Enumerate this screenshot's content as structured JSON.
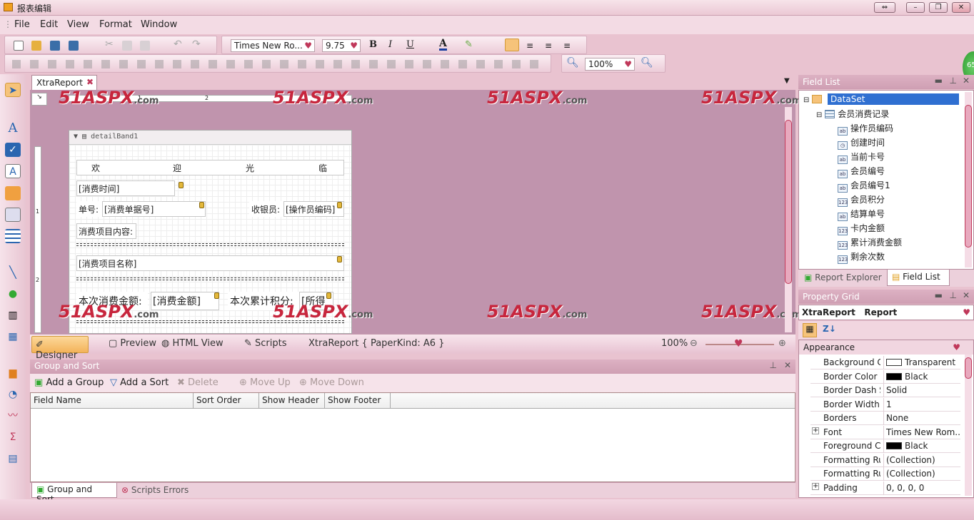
{
  "window": {
    "title": "报表编辑"
  },
  "menu": [
    "File",
    "Edit",
    "View",
    "Format",
    "Window"
  ],
  "font_toolbar": {
    "font_name": "Times New Ro...",
    "font_size": "9.75",
    "bold": "B",
    "italic": "I",
    "underline": "U",
    "font_color": "A"
  },
  "zoom_toolbar": {
    "zoom": "100%"
  },
  "doc_tab": {
    "label": "XtraReport"
  },
  "band": {
    "label": "detailBand1"
  },
  "report_cells": {
    "welcome": [
      "欢",
      "迎",
      "光",
      "临"
    ],
    "time": "[消费时间]",
    "order_label": "单号:",
    "order_field": "[消费单据号]",
    "cashier_label": "收银员:",
    "cashier_field": "[操作员编码]",
    "items_label": "消费项目内容:",
    "item_name": "[消费项目名称]",
    "amount_label": "本次消费金额:",
    "amount_field": "[消费金额]",
    "points_label": "本次累计积分:",
    "points_field": "[所得"
  },
  "watermark": {
    "brand": "51ASPX",
    "suffix": ".com"
  },
  "ruler": {
    "marks": [
      "1",
      "2"
    ]
  },
  "bottom_tabs": {
    "designer": "Designer",
    "preview": "Preview",
    "html_view": "HTML View",
    "scripts": "Scripts",
    "status": "XtraReport { PaperKind: A6 }",
    "zoom": "100%"
  },
  "group_sort": {
    "title": "Group and Sort",
    "tools": {
      "add_group": "Add a Group",
      "add_sort": "Add a Sort",
      "delete": "Delete",
      "move_up": "Move Up",
      "move_down": "Move Down"
    },
    "columns": [
      "Field Name",
      "Sort Order",
      "Show Header",
      "Show Footer"
    ],
    "tabs": {
      "group_sort": "Group and Sort",
      "scripts_errors": "Scripts Errors"
    }
  },
  "field_list": {
    "title": "Field List",
    "root": "DataSet",
    "table": "会员消费记录",
    "fields": [
      {
        "name": "操作员编码",
        "icon": "ab"
      },
      {
        "name": "创建时间",
        "icon": "clock"
      },
      {
        "name": "当前卡号",
        "icon": "ab"
      },
      {
        "name": "会员编号",
        "icon": "ab"
      },
      {
        "name": "会员编号1",
        "icon": "ab"
      },
      {
        "name": "会员积分",
        "icon": "123"
      },
      {
        "name": "结算单号",
        "icon": "ab"
      },
      {
        "name": "卡内金额",
        "icon": "123"
      },
      {
        "name": "累计消费金额",
        "icon": "123"
      },
      {
        "name": "剩余次数",
        "icon": "123"
      }
    ],
    "tabs": {
      "report_explorer": "Report Explorer",
      "field_list": "Field List"
    }
  },
  "property_grid": {
    "title": "Property Grid",
    "selected_name": "XtraReport",
    "selected_type": "Report",
    "category": "Appearance",
    "rows": [
      {
        "name": "Background Cc",
        "value": "Transparent",
        "swatch": "#ffffff"
      },
      {
        "name": "Border Color",
        "value": "Black",
        "swatch": "#000000"
      },
      {
        "name": "Border Dash St",
        "value": "Solid"
      },
      {
        "name": "Border Width",
        "value": "1"
      },
      {
        "name": "Borders",
        "value": "None"
      },
      {
        "name": "Font",
        "value": "Times New Rom...",
        "expand": "+"
      },
      {
        "name": "Foreground Cc",
        "value": "Black",
        "swatch": "#000000"
      },
      {
        "name": "Formatting Rul",
        "value": "(Collection)"
      },
      {
        "name": "Formatting Rul",
        "value": "(Collection)"
      },
      {
        "name": "Padding",
        "value": "0, 0, 0, 0",
        "expand": "+"
      }
    ]
  },
  "badge": "65",
  "colors": {
    "accent": "#c7263d",
    "panel_header": "#cf9fb3",
    "canvas": "#c094ad"
  }
}
